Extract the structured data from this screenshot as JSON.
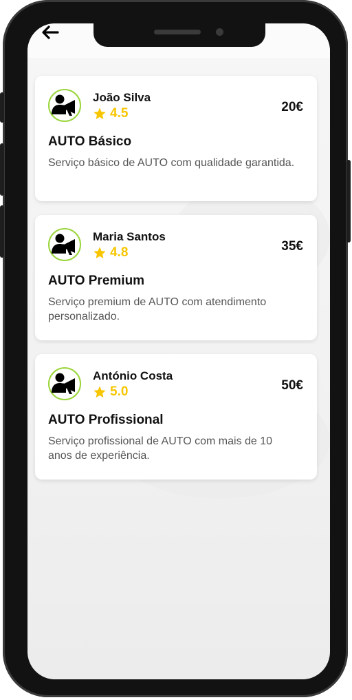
{
  "header": {
    "back_icon": "arrow-left-icon"
  },
  "colors": {
    "rating": "#f7c600",
    "avatar_ring": "#9ad53a",
    "text": "#111111",
    "muted": "#555555"
  },
  "services": [
    {
      "provider": "João Silva",
      "rating": "4.5",
      "price": "20€",
      "title": "AUTO Básico",
      "description": "Serviço básico de AUTO com qualidade garantida.",
      "avatar_icon": "person-megaphone-icon"
    },
    {
      "provider": "Maria Santos",
      "rating": "4.8",
      "price": "35€",
      "title": "AUTO Premium",
      "description": "Serviço premium de AUTO com atendimento personalizado.",
      "avatar_icon": "person-megaphone-icon"
    },
    {
      "provider": "António Costa",
      "rating": "5.0",
      "price": "50€",
      "title": "AUTO Profissional",
      "description": "Serviço profissional de AUTO com mais de 10 anos de experiência.",
      "avatar_icon": "person-megaphone-icon"
    }
  ]
}
